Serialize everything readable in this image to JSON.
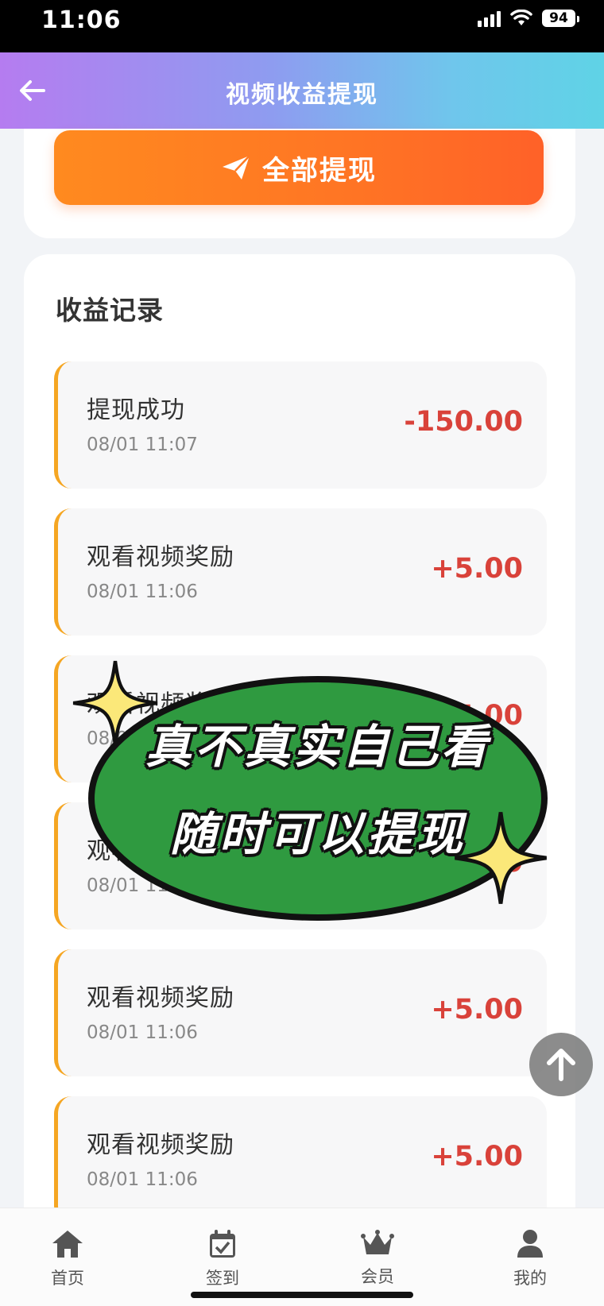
{
  "status_bar": {
    "time": "11:06",
    "battery": "94"
  },
  "header": {
    "title": "视频收益提现"
  },
  "withdraw": {
    "label": "全部提现"
  },
  "records": {
    "title": "收益记录",
    "items": [
      {
        "title": "提现成功",
        "time": "08/01 11:07",
        "amount": "-150.00"
      },
      {
        "title": "观看视频奖励",
        "time": "08/01 11:06",
        "amount": "+5.00"
      },
      {
        "title": "观看视频奖励",
        "time": "08/01 11:06",
        "amount": "+5.00"
      },
      {
        "title": "观看视频奖励",
        "time": "08/01 11:06",
        "amount": "+5.00"
      },
      {
        "title": "观看视频奖励",
        "time": "08/01 11:06",
        "amount": "+5.00"
      },
      {
        "title": "观看视频奖励",
        "time": "08/01 11:06",
        "amount": "+5.00"
      }
    ]
  },
  "promo": {
    "line1": "真不真实自己看",
    "line2": "随时可以提现"
  },
  "nav": [
    {
      "label": "首页",
      "icon": "home-icon"
    },
    {
      "label": "签到",
      "icon": "calendar-check-icon"
    },
    {
      "label": "会员",
      "icon": "crown-icon"
    },
    {
      "label": "我的",
      "icon": "user-icon"
    }
  ],
  "colors": {
    "accent": "#ff7524",
    "amount": "#d9423a",
    "record_bar": "#f5a623",
    "promo_bg": "#2f9a40"
  }
}
